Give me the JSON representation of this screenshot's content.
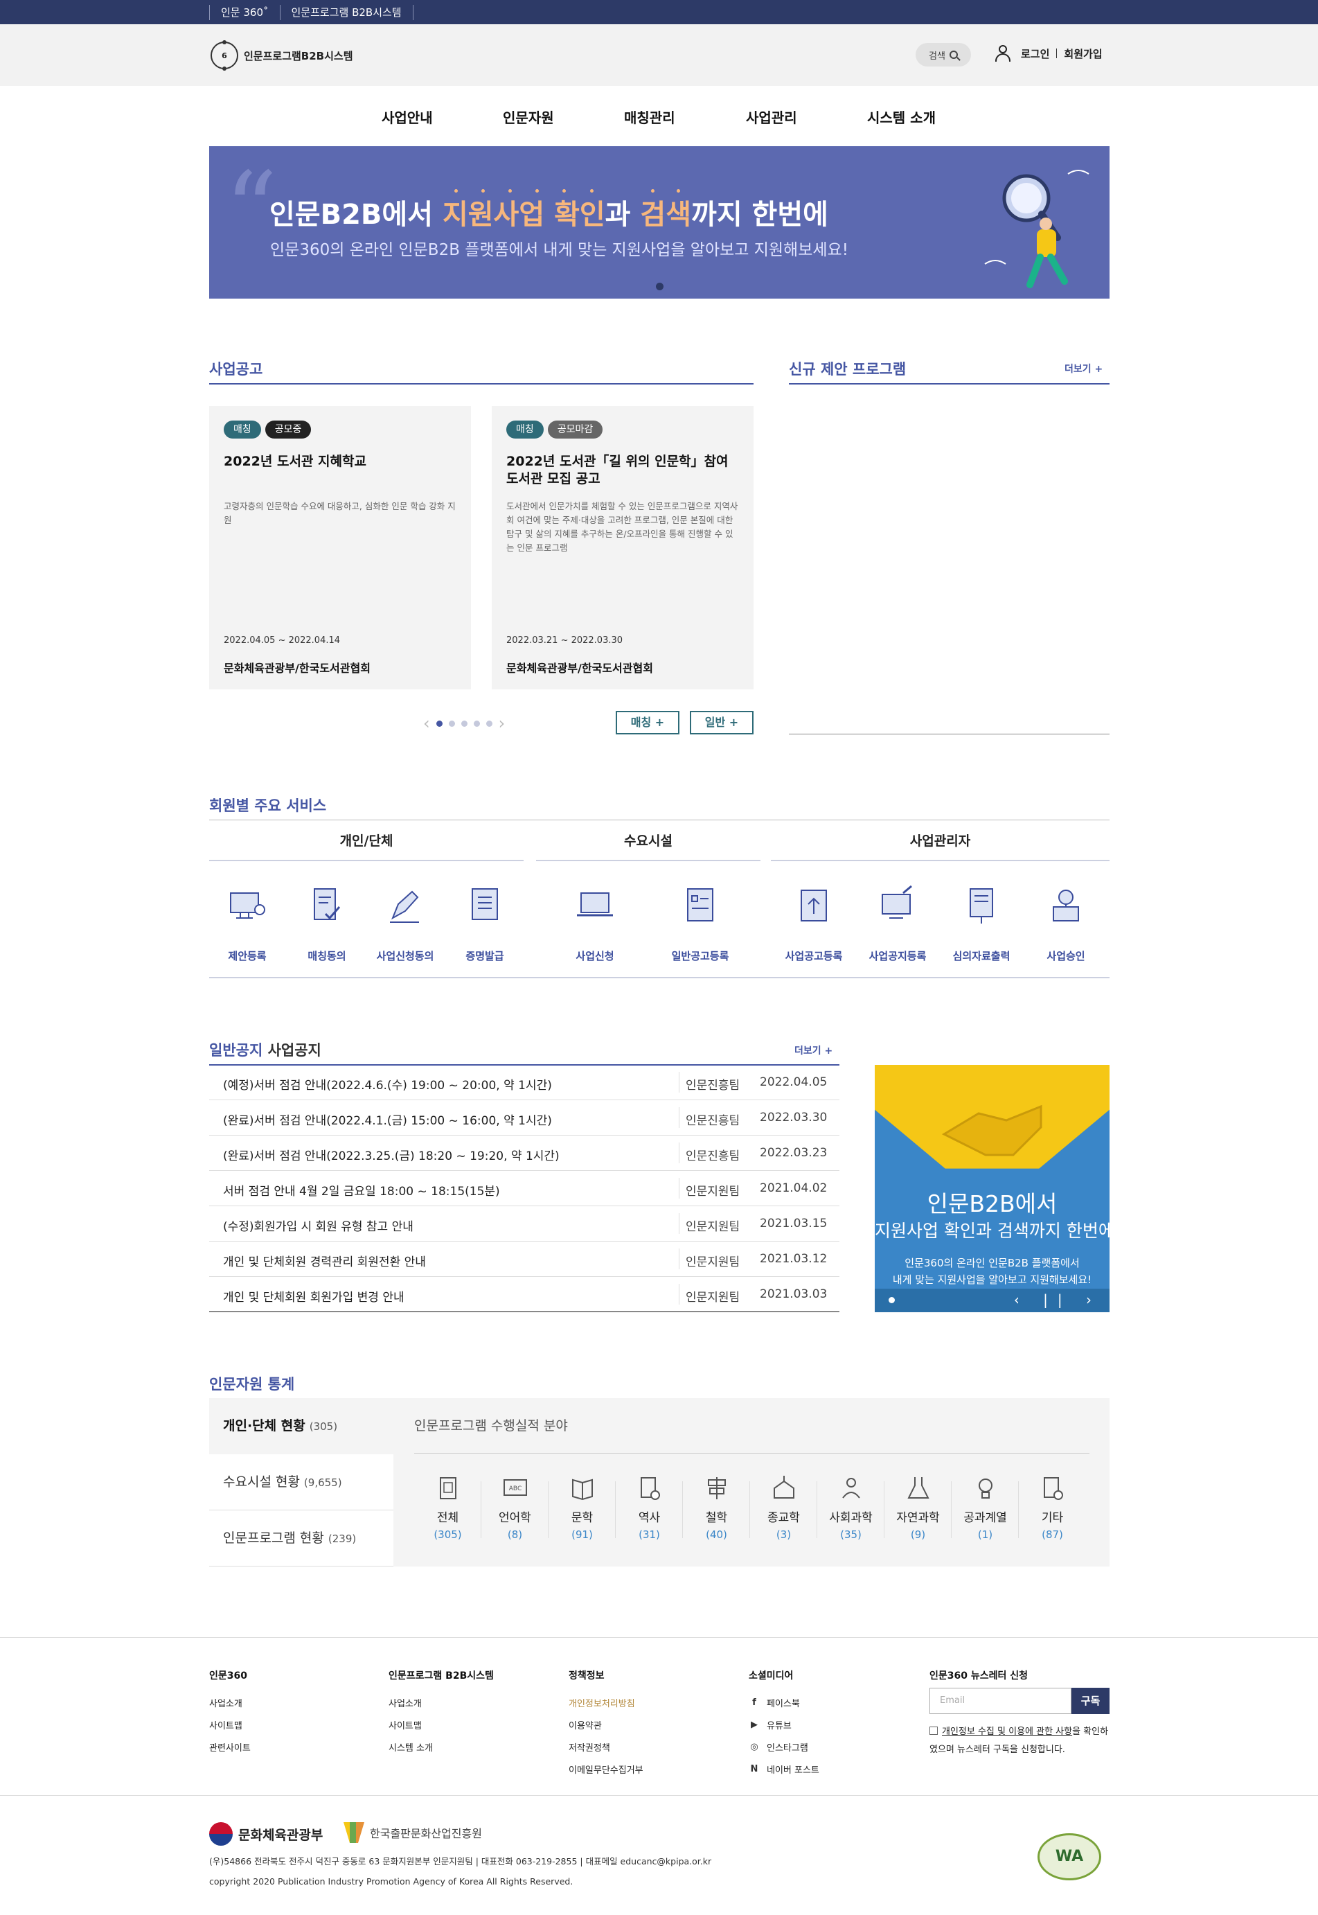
{
  "topbar": {
    "links": [
      "인문 360˚",
      "인문프로그램 B2B시스템"
    ]
  },
  "header": {
    "logo_text": "인문프로그램B2B시스템",
    "logo_mark": "6",
    "search_label": "검색",
    "login": "로그인",
    "signup": "회원가입"
  },
  "gnb": [
    "사업안내",
    "인문자원",
    "매칭관리",
    "사업관리",
    "시스템 소개"
  ],
  "banner": {
    "headline_a": "인문B2B에서 ",
    "headline_hl1": "지원사업 확인",
    "headline_b": "과 ",
    "headline_hl2": "검색",
    "headline_c": "까지 한번에",
    "sub": "인문360의 온라인 인문B2B 플랫폼에서 내게 맞는 지원사업을 알아보고 지원해보세요!"
  },
  "business": {
    "title": "사업공고",
    "cards": [
      {
        "badges": [
          "매칭",
          "공모중"
        ],
        "title": "2022년 도서관 지혜학교",
        "desc": "고령자층의 인문학습 수요에 대응하고, 심화한 인문 학습 강화 지원",
        "date": "2022.04.05 ~ 2022.04.14",
        "org": "문화체육관광부/한국도서관협회"
      },
      {
        "badges": [
          "매칭",
          "공모마감"
        ],
        "title": "2022년 도서관「길 위의 인문학」참여 도서관 모집 공고",
        "desc": "도서관에서 인문가치를 체험할 수 있는 인문프로그램으로 지역사회 여건에 맞는 주제·대상을 고려한 프로그램, 인문 본질에 대한 탐구 및 삶의 지혜를 추구하는 온/오프라인을 통해 진행할 수 있는 인문 프로그램",
        "date": "2022.03.21 ~ 2022.03.30",
        "org": "문화체육관광부/한국도서관협회"
      }
    ],
    "btn_matching": "매칭 +",
    "btn_general": "일반 +"
  },
  "new_program": {
    "title": "신규 제안 프로그램",
    "more": "더보기 +"
  },
  "services": {
    "title": "회원별 주요 서비스",
    "groups": [
      "개인/단체",
      "수요시설",
      "사업관리자"
    ],
    "items": [
      "제안등록",
      "매칭동의",
      "사업신청동의",
      "증명발급",
      "사업신청",
      "일반공고등록",
      "사업공고등록",
      "사업공지등록",
      "심의자료출력",
      "사업승인"
    ]
  },
  "notice": {
    "title_a": "일반공지",
    "title_b": " 사업공지",
    "more": "더보기 +",
    "rows": [
      {
        "title": "(예정)서버 점검 안내(2022.4.6.(수) 19:00 ~ 20:00, 약 1시간)",
        "org": "인문진흥팀",
        "date": "2022.04.05"
      },
      {
        "title": "(완료)서버 점검 안내(2022.4.1.(금) 15:00 ~ 16:00, 약 1시간)",
        "org": "인문진흥팀",
        "date": "2022.03.30"
      },
      {
        "title": "(완료)서버 점검 안내(2022.3.25.(금) 18:20 ~ 19:20, 약 1시간)",
        "org": "인문진흥팀",
        "date": "2022.03.23"
      },
      {
        "title": "서버 점검 안내 4월 2일 금요일 18:00 ~ 18:15(15분)",
        "org": "인문지원팀",
        "date": "2021.04.02"
      },
      {
        "title": "(수정)회원가입 시 회원 유형 참고 안내",
        "org": "인문지원팀",
        "date": "2021.03.15"
      },
      {
        "title": "개인 및 단체회원 경력관리 회원전환 안내",
        "org": "인문지원팀",
        "date": "2021.03.12"
      },
      {
        "title": "개인 및 단체회원 회원가입 변경 안내",
        "org": "인문지원팀",
        "date": "2021.03.03"
      }
    ]
  },
  "promo": {
    "line1": "인문B2B에서",
    "line2": "지원사업 확인과 검색까지 한번에",
    "line3a": "인문360의 온라인 인문B2B 플랫폼에서",
    "line3b": "내게 맞는 지원사업을 알아보고 지원해보세요!",
    "controls": "‹ || ›"
  },
  "stats": {
    "title": "인문자원 통계",
    "tabs": [
      {
        "label": "개인·단체 현황",
        "count": "(305)"
      },
      {
        "label": "수요시설 현황",
        "count": "(9,655)"
      },
      {
        "label": "인문프로그램 현황",
        "count": "(239)"
      }
    ],
    "subtitle": "인문프로그램 수행실적 분야",
    "cats": [
      {
        "label": "전체",
        "count": "(305)"
      },
      {
        "label": "언어학",
        "count": "(8)"
      },
      {
        "label": "문학",
        "count": "(91)"
      },
      {
        "label": "역사",
        "count": "(31)"
      },
      {
        "label": "철학",
        "count": "(40)"
      },
      {
        "label": "종교학",
        "count": "(3)"
      },
      {
        "label": "사회과학",
        "count": "(35)"
      },
      {
        "label": "자연과학",
        "count": "(9)"
      },
      {
        "label": "공과계열",
        "count": "(1)"
      },
      {
        "label": "기타",
        "count": "(87)"
      }
    ]
  },
  "footer": {
    "cols": [
      {
        "head": "인문360",
        "items": [
          "사업소개",
          "사이트맵",
          "관련사이트"
        ]
      },
      {
        "head": "인문프로그램 B2B시스템",
        "items": [
          "사업소개",
          "사이트맵",
          "시스템 소개"
        ]
      },
      {
        "head": "정책정보",
        "items": [
          "개인정보처리방침",
          "이용약관",
          "저작권정책",
          "이메일무단수집거부"
        ]
      },
      {
        "head": "소셜미디어",
        "items": [
          "페이스북",
          "유튜브",
          "인스타그램",
          "네이버 포스트"
        ]
      }
    ],
    "social_icons": [
      "f",
      "▶",
      "◎",
      "N"
    ],
    "newsletter_head": "인문360 뉴스레터 신청",
    "email_placeholder": "Email",
    "subscribe": "구독",
    "agree_link": "개인정보 수집 및 이용에 관한 사항",
    "agree_a": "을 확인하였으며 뉴스레터 구독을 신청합니다.",
    "ministry": "문화체육관광부",
    "kpipa": "한국출판문화산업진흥원",
    "address": "(우)54866 전라북도 전주시 덕진구 중동로 63 문화지원본부 인문지원팀  |  대표전화 063-219-2855  |  대표메일 educanc@kpipa.or.kr",
    "copyright": "copyright 2020 Publication Industry Promotion Agency of Korea All Rights Reserved.",
    "wa_mark": "WA"
  },
  "colors": {
    "navy": "#2d3a67",
    "accent": "#4556a3",
    "banner": "#5c69b0",
    "teal": "#2e6b78",
    "highlight": "#f7b77c"
  }
}
